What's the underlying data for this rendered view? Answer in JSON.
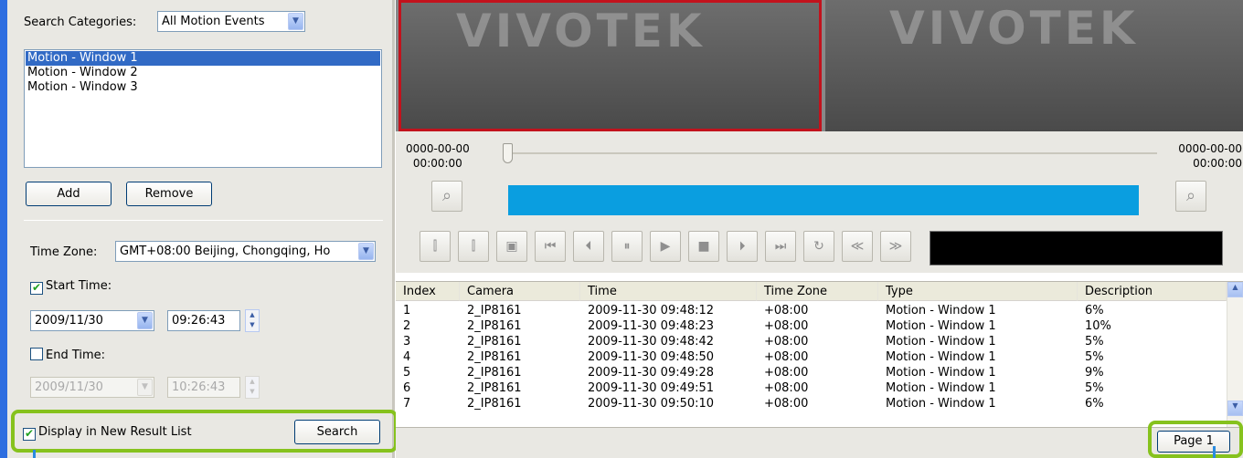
{
  "search": {
    "categories_label": "Search Categories:",
    "category_value": "All Motion Events",
    "list_items": [
      "Motion - Window 1",
      "Motion - Window 2",
      "Motion - Window 3"
    ],
    "add_label": "Add",
    "remove_label": "Remove",
    "timezone_label": "Time Zone:",
    "timezone_value": "GMT+08:00 Beijing, Chongqing, Ho",
    "start_label": "Start Time:",
    "start_date": "2009/11/30",
    "start_time": "09:26:43",
    "end_label": "End Time:",
    "end_date": "2009/11/30",
    "end_time": "10:26:43",
    "display_new_label": "Display in New Result List",
    "search_label": "Search"
  },
  "video": {
    "logo_text": "VIVOTEK",
    "start_date": "0000-00-00",
    "start_time": "00:00:00",
    "end_date": "0000-00-00",
    "end_time": "00:00:00"
  },
  "table": {
    "headers": [
      "Index",
      "Camera",
      "Time",
      "Time Zone",
      "Type",
      "Description"
    ],
    "rows": [
      [
        "1",
        "2_IP8161",
        "2009-11-30 09:48:12",
        "+08:00",
        "Motion - Window 1",
        "6%"
      ],
      [
        "2",
        "2_IP8161",
        "2009-11-30 09:48:23",
        "+08:00",
        "Motion - Window 1",
        "10%"
      ],
      [
        "3",
        "2_IP8161",
        "2009-11-30 09:48:42",
        "+08:00",
        "Motion - Window 1",
        "5%"
      ],
      [
        "4",
        "2_IP8161",
        "2009-11-30 09:48:50",
        "+08:00",
        "Motion - Window 1",
        "5%"
      ],
      [
        "5",
        "2_IP8161",
        "2009-11-30 09:49:28",
        "+08:00",
        "Motion - Window 1",
        "9%"
      ],
      [
        "6",
        "2_IP8161",
        "2009-11-30 09:49:51",
        "+08:00",
        "Motion - Window 1",
        "5%"
      ],
      [
        "7",
        "2_IP8161",
        "2009-11-30 09:50:10",
        "+08:00",
        "Motion - Window 1",
        "6%"
      ]
    ]
  },
  "status": {
    "page_label": "Page 1"
  },
  "colors": {
    "highlight": "#86c21d",
    "selection": "#316ac5",
    "progress": "#0a9ee0"
  }
}
